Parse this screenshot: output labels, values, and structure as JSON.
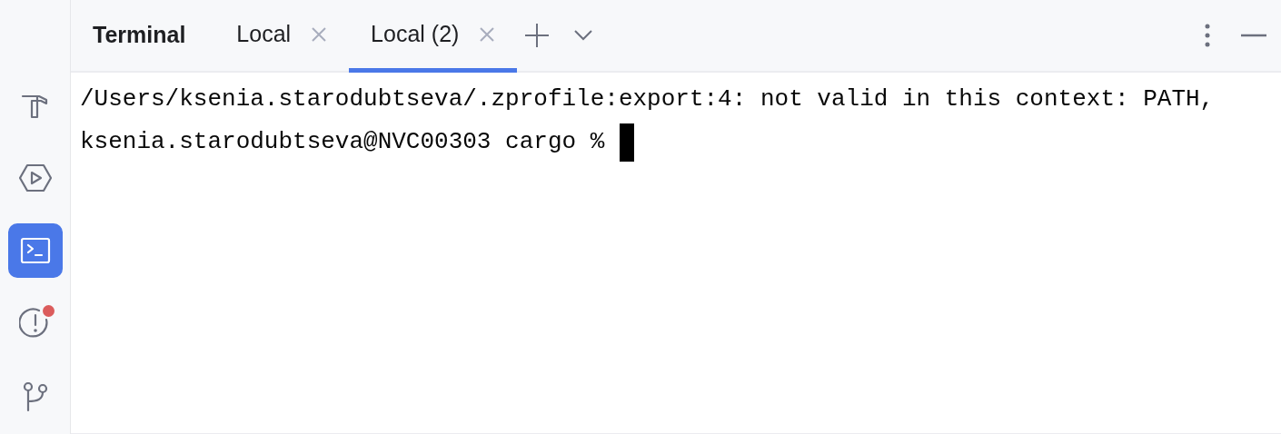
{
  "sidebar": {
    "items": [
      {
        "kind": "build",
        "selected": false,
        "notification": false
      },
      {
        "kind": "run",
        "selected": false,
        "notification": false
      },
      {
        "kind": "terminal",
        "selected": true,
        "notification": false
      },
      {
        "kind": "problems",
        "selected": false,
        "notification": true
      },
      {
        "kind": "git",
        "selected": false,
        "notification": false
      }
    ]
  },
  "panel": {
    "title": "Terminal",
    "tabs": [
      {
        "label": "Local",
        "selected": false
      },
      {
        "label": "Local (2)",
        "selected": true
      }
    ]
  },
  "terminal": {
    "lines": [
      "/Users/ksenia.starodubtseva/.zprofile:export:4: not valid in this context: PATH,",
      "ksenia.starodubtseva@NVC00303 cargo %"
    ]
  }
}
